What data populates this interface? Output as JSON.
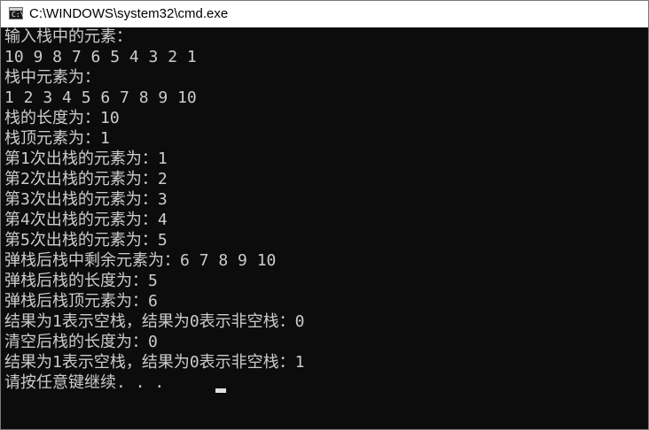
{
  "window": {
    "title": "C:\\WINDOWS\\system32\\cmd.exe",
    "icon": "cmd-console-icon",
    "icon_prompt": "C:\\"
  },
  "console": {
    "background": "#0c0c0c",
    "foreground": "#cccccc",
    "lines": [
      "输入栈中的元素：",
      "10 9 8 7 6 5 4 3 2 1",
      "栈中元素为：",
      "1 2 3 4 5 6 7 8 9 10",
      "栈的长度为：10",
      "栈顶元素为：1",
      "第1次出栈的元素为：1",
      "第2次出栈的元素为：2",
      "第3次出栈的元素为：3",
      "第4次出栈的元素为：4",
      "第5次出栈的元素为：5",
      "弹栈后栈中剩余元素为：6 7 8 9 10",
      "弹栈后栈的长度为：5",
      "弹栈后栈顶元素为：6",
      "结果为1表示空栈，结果为0表示非空栈：0",
      "清空后栈的长度为：0",
      "结果为1表示空栈，结果为0表示非空栈：1",
      "请按任意键继续. . ."
    ]
  }
}
